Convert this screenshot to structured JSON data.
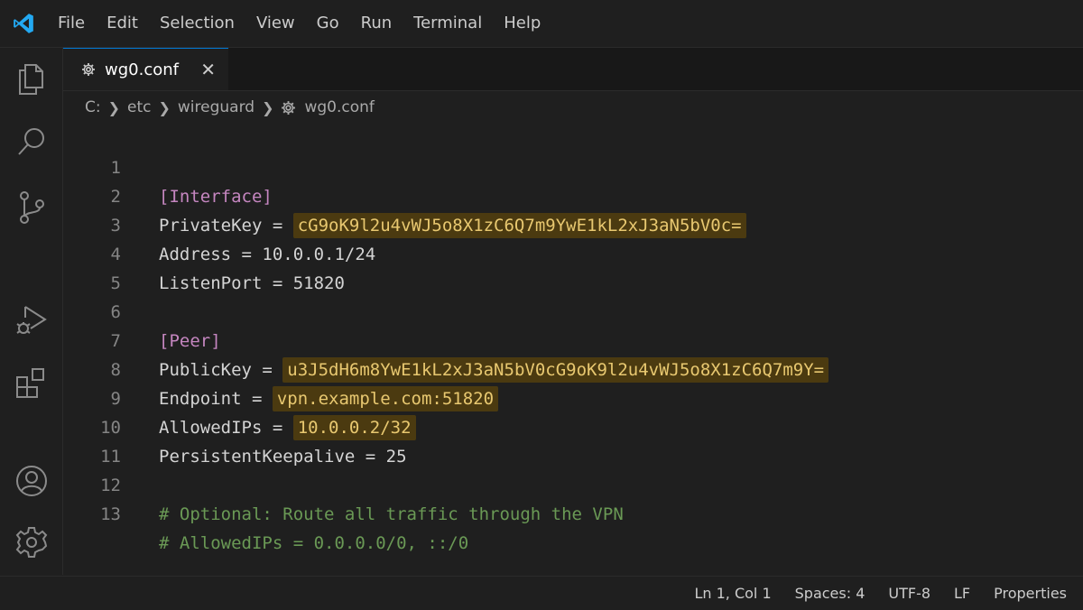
{
  "menu": {
    "items": [
      "File",
      "Edit",
      "Selection",
      "View",
      "Go",
      "Run",
      "Terminal",
      "Help"
    ]
  },
  "activity_bar": {
    "icons": [
      "explorer-icon",
      "search-icon",
      "source-control-icon",
      "run-debug-icon",
      "extensions-icon",
      "account-icon",
      "manage-gear-icon"
    ]
  },
  "tab": {
    "label": "wg0.conf",
    "close": "✕"
  },
  "breadcrumb": {
    "drive": "C:",
    "folder1": "etc",
    "folder2": "wireguard",
    "file": "wg0.conf"
  },
  "editor": {
    "lines": [
      {
        "n": "1",
        "section": "[Interface]"
      },
      {
        "n": "2",
        "key": "PrivateKey",
        "op": " = ",
        "value": "cG9oK9l2u4vWJ5o8X1zC6Q7m9YwE1kL2xJ3aN5bV0c=",
        "highlight": true
      },
      {
        "n": "3",
        "key": "Address",
        "op": " = ",
        "value": "10.0.0.1/24",
        "highlight": false
      },
      {
        "n": "4",
        "key": "ListenPort",
        "op": " = ",
        "value": "51820",
        "highlight": false
      },
      {
        "n": "5"
      },
      {
        "n": "6",
        "section": "[Peer]"
      },
      {
        "n": "7",
        "key": "PublicKey",
        "op": " = ",
        "value": "u3J5dH6m8YwE1kL2xJ3aN5bV0cG9oK9l2u4vWJ5o8X1zC6Q7m9Y=",
        "highlight": true
      },
      {
        "n": "8",
        "key": "Endpoint",
        "op": " = ",
        "value": "vpn.example.com:51820",
        "highlight": true
      },
      {
        "n": "9",
        "key": "AllowedIPs",
        "op": " = ",
        "value": "10.0.0.2/32",
        "highlight": true
      },
      {
        "n": "10",
        "key": "PersistentKeepalive",
        "op": " = ",
        "value": "25",
        "highlight": false
      },
      {
        "n": "11"
      },
      {
        "n": "12",
        "comment": "# Optional: Route all traffic through the VPN"
      },
      {
        "n": "13",
        "comment": "# AllowedIPs = 0.0.0.0/0, ::/0"
      }
    ]
  },
  "status": {
    "position": "Ln 1, Col 1",
    "indent": "Spaces: 4",
    "encoding": "UTF-8",
    "eol": "LF",
    "language": "Properties"
  },
  "colors": {
    "accent": "#0078d4",
    "section": "#c586c0",
    "highlight_bg": "#4b3a10",
    "highlight_fg": "#e8c870",
    "comment": "#6a9955"
  }
}
